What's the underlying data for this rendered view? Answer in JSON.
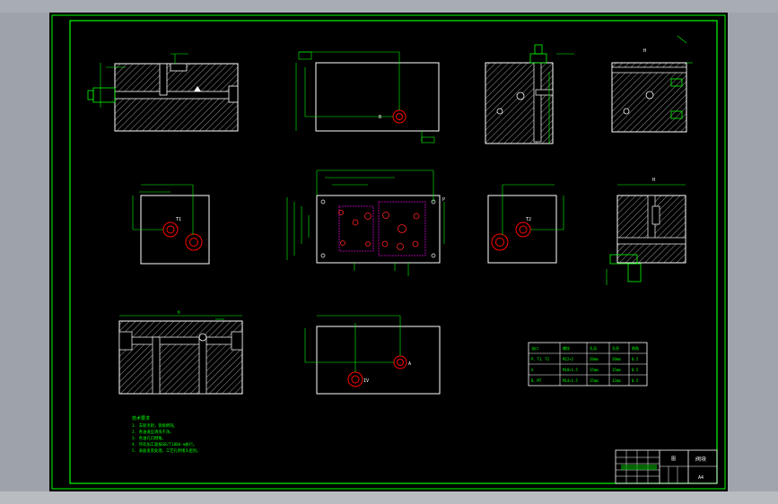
{
  "drawing": {
    "background": "#000000",
    "line_color": "#ffffff",
    "dim_color": "#00ff00",
    "hidden_color": "#ff2222",
    "hole_color": "#ff0000",
    "accent_color": "#cc00cc"
  },
  "labels": {
    "port_b": "B",
    "port_t1": "T1",
    "port_t2": "T2",
    "port_iv": "IV",
    "port_a": "A",
    "view_p": "P",
    "view_h": "H",
    "view_m": "M"
  },
  "notes": {
    "title": "技术要求",
    "lines": [
      "1. 去除毛刺，锐角倒钝。",
      "2. 各油道应清洗干净。",
      "3. 各油孔口倒角。",
      "4. 所有加工面按GB/T1804-m执行。",
      "5. 表面发黑处理，工艺孔用堵头密封。"
    ]
  },
  "table": {
    "headers": [
      "油口",
      "螺纹",
      "孔深",
      "孔径",
      "倒角"
    ],
    "rows": [
      [
        "P、T1、T2",
        "M22×2",
        "20mm",
        "20mm",
        "0.5"
      ],
      [
        "A",
        "M18×1.5",
        "15mm",
        "15mm",
        "0.5"
      ],
      [
        "B、MT",
        "M14×1.5",
        "15mm",
        "12mm",
        "0.5"
      ]
    ]
  },
  "title_block": {
    "name": "阀块",
    "scale": "A4",
    "sheet": "图"
  }
}
